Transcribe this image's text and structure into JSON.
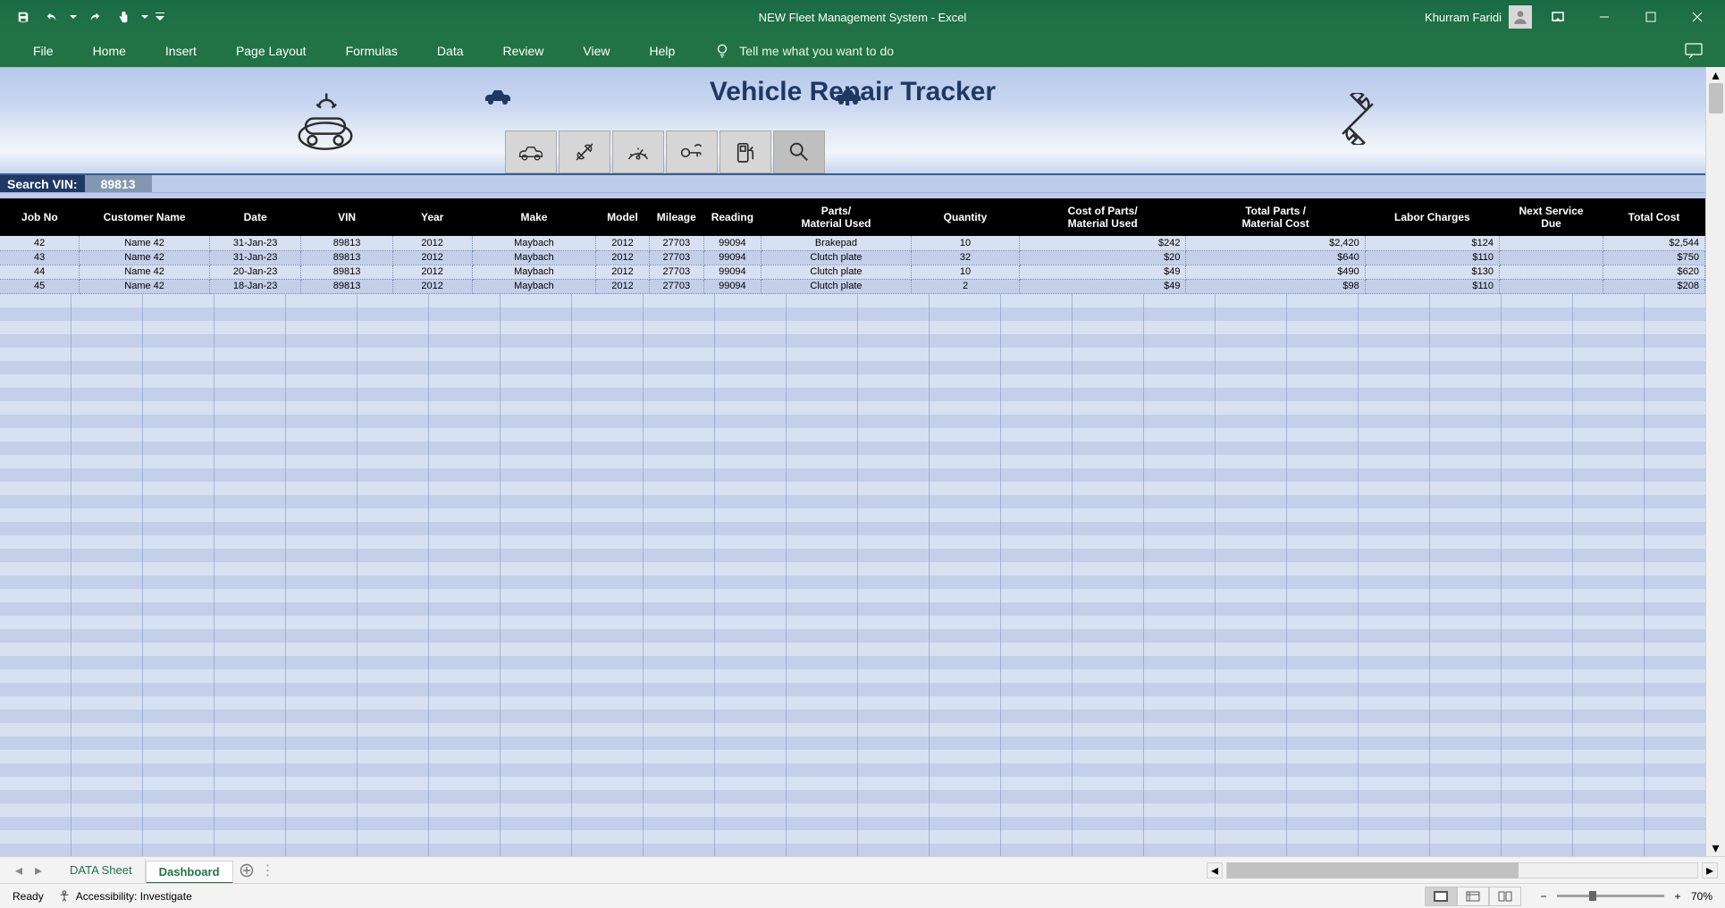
{
  "titlebar": {
    "doc_title": "NEW Fleet Management System  -  Excel",
    "user": "Khurram Faridi"
  },
  "ribbon": {
    "tabs": [
      "File",
      "Home",
      "Insert",
      "Page Layout",
      "Formulas",
      "Data",
      "Review",
      "View",
      "Help"
    ],
    "tell_me": "Tell me what you want to do"
  },
  "header": {
    "title": "Vehicle Repair Tracker"
  },
  "search": {
    "label": "Search VIN:",
    "value": "89813"
  },
  "table": {
    "headers": [
      "Job No",
      "Customer Name",
      "Date",
      "VIN",
      "Year",
      "Make",
      "Model",
      "Mileage",
      "Reading",
      "Parts/\nMaterial Used",
      "Quantity",
      "Cost of Parts/\nMaterial Used",
      "Total Parts /\nMaterial Cost",
      "Labor Charges",
      "Next Service\nDue",
      "Total Cost"
    ],
    "rows": [
      {
        "job": "42",
        "cust": "Name 42",
        "date": "31-Jan-23",
        "vin": "89813",
        "year": "2012",
        "make": "Maybach",
        "model": "2012",
        "mileage": "27703",
        "reading": "99094",
        "parts": "Brakepad",
        "qty": "10",
        "cop": "$242",
        "tpc": "$2,420",
        "labor": "$124",
        "nsd": "",
        "total": "$2,544"
      },
      {
        "job": "43",
        "cust": "Name 42",
        "date": "31-Jan-23",
        "vin": "89813",
        "year": "2012",
        "make": "Maybach",
        "model": "2012",
        "mileage": "27703",
        "reading": "99094",
        "parts": "Clutch plate",
        "qty": "32",
        "cop": "$20",
        "tpc": "$640",
        "labor": "$110",
        "nsd": "",
        "total": "$750"
      },
      {
        "job": "44",
        "cust": "Name 42",
        "date": "20-Jan-23",
        "vin": "89813",
        "year": "2012",
        "make": "Maybach",
        "model": "2012",
        "mileage": "27703",
        "reading": "99094",
        "parts": "Clutch plate",
        "qty": "10",
        "cop": "$49",
        "tpc": "$490",
        "labor": "$130",
        "nsd": "",
        "total": "$620"
      },
      {
        "job": "45",
        "cust": "Name 42",
        "date": "18-Jan-23",
        "vin": "89813",
        "year": "2012",
        "make": "Maybach",
        "model": "2012",
        "mileage": "27703",
        "reading": "99094",
        "parts": "Clutch plate",
        "qty": "2",
        "cop": "$49",
        "tpc": "$98",
        "labor": "$110",
        "nsd": "",
        "total": "$208"
      }
    ]
  },
  "sheets": {
    "tabs": [
      "DATA Sheet",
      "Dashboard"
    ],
    "active": 1
  },
  "statusbar": {
    "ready": "Ready",
    "accessibility": "Accessibility: Investigate",
    "zoom": "70%"
  }
}
